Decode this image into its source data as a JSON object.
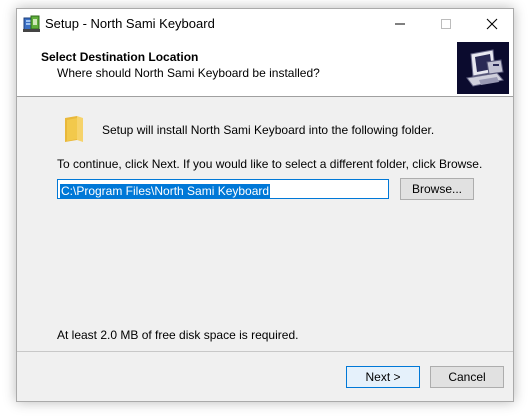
{
  "window": {
    "title": "Setup - North Sami Keyboard",
    "controls": {
      "minimize": "minimize-icon",
      "maximize": "maximize-icon",
      "close": "close-icon"
    }
  },
  "header": {
    "title": "Select Destination Location",
    "subtitle": "Where should North Sami Keyboard be installed?"
  },
  "content": {
    "install_text": "Setup will install North Sami Keyboard into the following folder.",
    "continue_text": "To continue, click Next. If you would like to select a different folder, click Browse.",
    "path_value": "C:\\Program Files\\North Sami Keyboard",
    "browse_label": "Browse...",
    "space_text": "At least 2.0 MB of free disk space is required."
  },
  "footer": {
    "next_label": "Next >",
    "cancel_label": "Cancel"
  },
  "colors": {
    "accent": "#0078d7",
    "window_bg": "#f0f0f0",
    "folder": "#f2c94c"
  }
}
